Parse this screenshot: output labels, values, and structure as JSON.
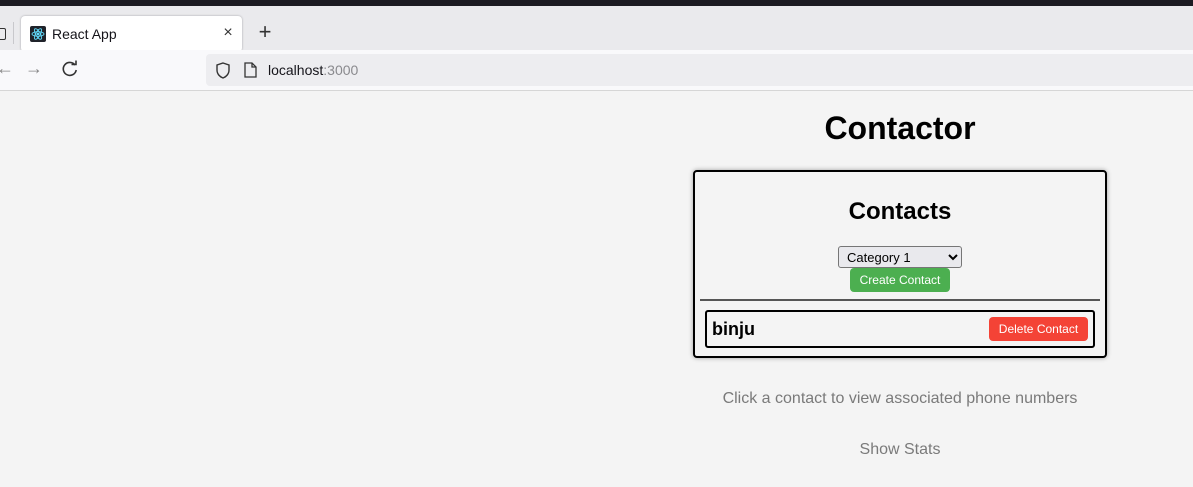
{
  "browser": {
    "tab_title": "React App",
    "tab_close": "×",
    "new_tab": "+",
    "url_host": "localhost",
    "url_port": ":3000"
  },
  "app": {
    "title": "Contactor",
    "panel_title": "Contacts",
    "category_options": [
      "Category 1"
    ],
    "category_selected": "Category 1",
    "create_label": "Create Contact",
    "contacts": [
      {
        "name": "binju",
        "delete_label": "Delete Contact"
      }
    ],
    "hint": "Click a contact to view associated phone numbers",
    "stats_label": "Show Stats"
  },
  "colors": {
    "create_button": "#4caf50",
    "delete_button": "#f44336",
    "page_background": "#f4f4f4"
  }
}
